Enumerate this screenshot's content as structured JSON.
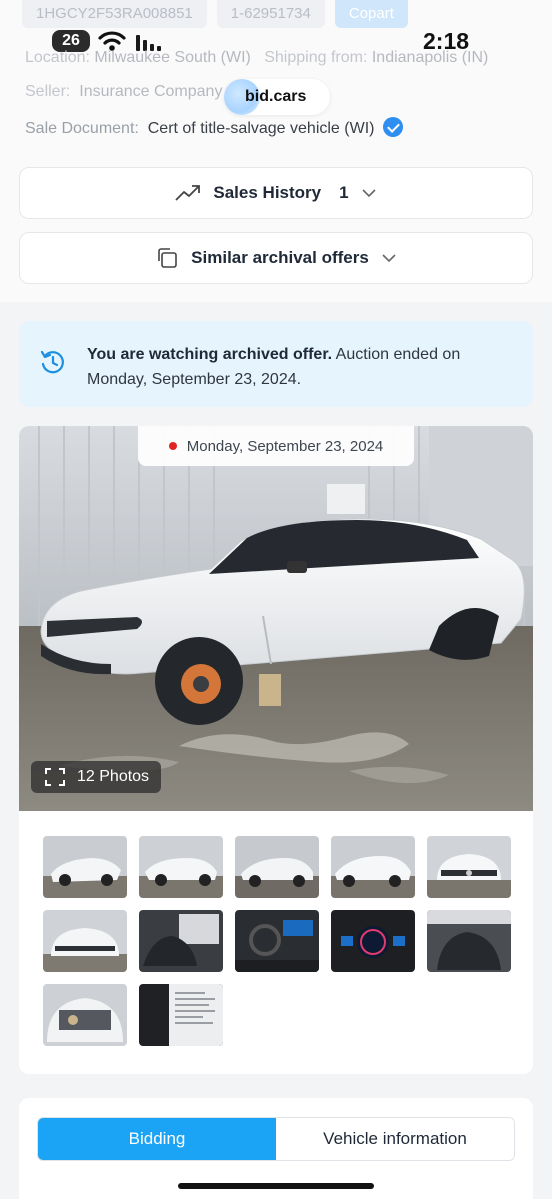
{
  "top_chips": [
    "1HGCY2F53RA008851",
    "1-62951734",
    "Copart"
  ],
  "status_bar": {
    "battery": "26",
    "time": "2:18"
  },
  "details": {
    "location_label": "Location:",
    "location_value": "Milwaukee South (WI)",
    "shipping_label": "Shipping from:",
    "shipping_value": "Indianapolis (IN)",
    "seller_label": "Seller:",
    "seller_value": "Insurance Company",
    "sale_doc_label": "Sale Document:",
    "sale_doc_value": "Cert of title-salvage vehicle (WI)"
  },
  "badge": {
    "text": "bid.cars"
  },
  "sales_history": {
    "label": "Sales History",
    "count": "1"
  },
  "similar_offers": {
    "label": "Similar archival offers"
  },
  "notice": {
    "bold": "You are watching archived offer.",
    "rest": " Auction ended on Monday, September 23, 2024."
  },
  "photo": {
    "date": "Monday, September 23, 2024",
    "count_label": "12 Photos"
  },
  "tabs": [
    "Bidding",
    "Vehicle information"
  ],
  "colors": {
    "accent": "#1ba3f5",
    "notice_bg": "#e6f4fd",
    "verified": "#2e8ff0"
  }
}
